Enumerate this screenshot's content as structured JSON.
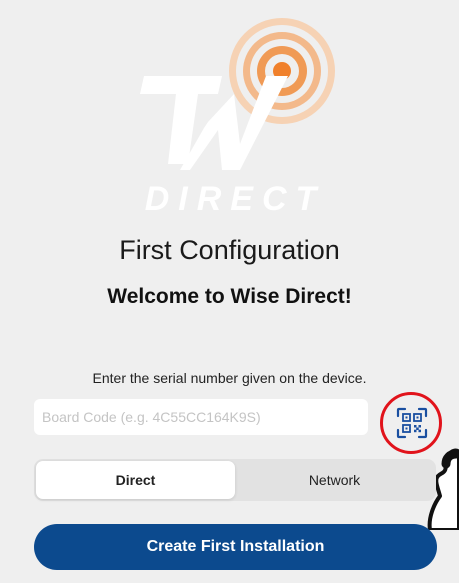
{
  "logo": {
    "wordmark": "DIRECT",
    "accent_color": "#f0802b"
  },
  "header": {
    "title": "First Configuration",
    "subtitle": "Welcome to Wise Direct!"
  },
  "form": {
    "instruction": "Enter the serial number given on the device.",
    "board_code_placeholder": "Board Code (e.g. 4C55CC164K9S)",
    "board_code_value": "",
    "qr_icon": "qr-code-scan-icon",
    "highlight_color": "#e1131b"
  },
  "connection_mode": {
    "options": [
      {
        "label": "Direct",
        "selected": true
      },
      {
        "label": "Network",
        "selected": false
      }
    ]
  },
  "actions": {
    "create_label": "Create First Installation",
    "primary_color": "#0c4a8e"
  }
}
